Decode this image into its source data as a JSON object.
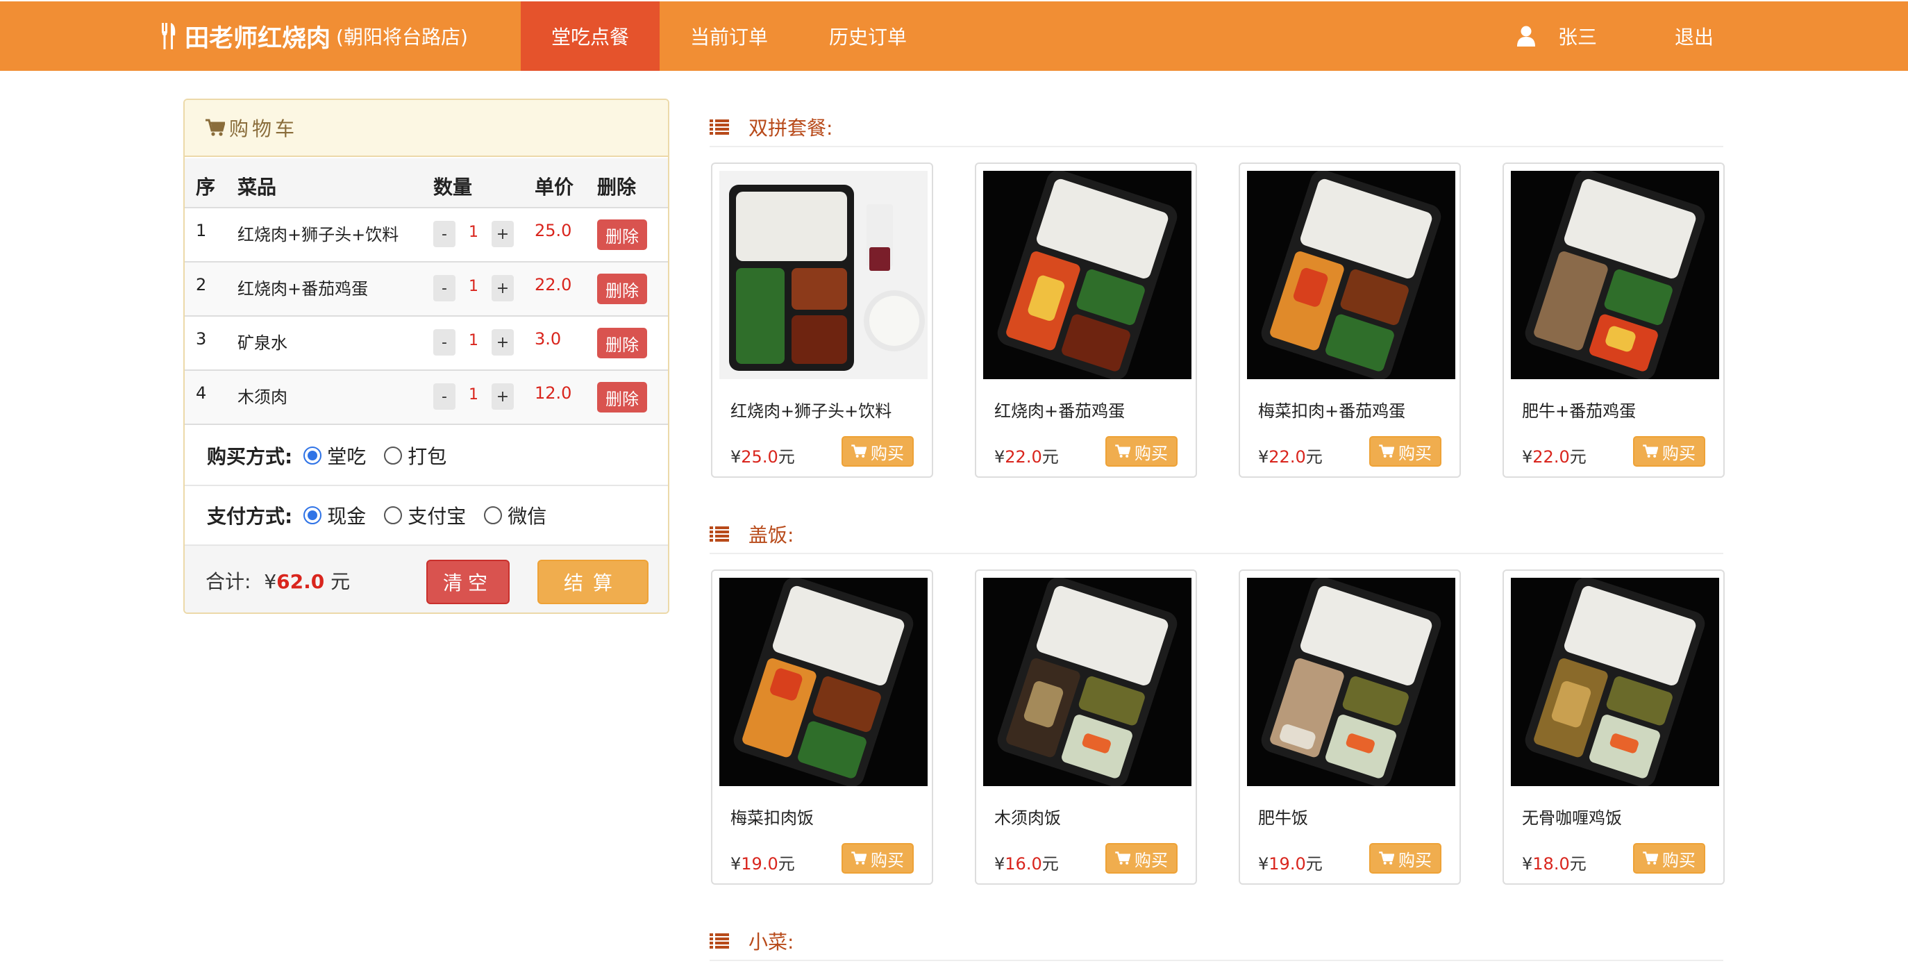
{
  "nav": {
    "brand_name": "田老师红烧肉",
    "brand_branch": "(朝阳将台路店)",
    "tabs": [
      {
        "label": "堂吃点餐",
        "active": true
      },
      {
        "label": "当前订单",
        "active": false
      },
      {
        "label": "历史订单",
        "active": false
      }
    ],
    "user_name": "张三",
    "logout_label": "退出",
    "icons": {
      "brand": "fork-knife-icon",
      "user": "user-icon"
    }
  },
  "cart": {
    "title": "购物车",
    "icon": "cart-icon",
    "headers": {
      "seq": "序",
      "name": "菜品",
      "qty": "数量",
      "price": "单价",
      "del": "删除"
    },
    "items": [
      {
        "seq": "1",
        "name": "红烧肉+狮子头+饮料",
        "qty": "1",
        "price": "25.0",
        "del": "删除",
        "minus": "-",
        "plus": "+"
      },
      {
        "seq": "2",
        "name": "红烧肉+番茄鸡蛋",
        "qty": "1",
        "price": "22.0",
        "del": "删除",
        "minus": "-",
        "plus": "+"
      },
      {
        "seq": "3",
        "name": "矿泉水",
        "qty": "1",
        "price": "3.0",
        "del": "删除",
        "minus": "-",
        "plus": "+"
      },
      {
        "seq": "4",
        "name": "木须肉",
        "qty": "1",
        "price": "12.0",
        "del": "删除",
        "minus": "-",
        "plus": "+"
      }
    ],
    "purchase_label": "购买方式:",
    "purchase_options": [
      {
        "label": "堂吃",
        "checked": true
      },
      {
        "label": "打包",
        "checked": false
      }
    ],
    "payment_label": "支付方式:",
    "payment_options": [
      {
        "label": "现金",
        "checked": true
      },
      {
        "label": "支付宝",
        "checked": false
      },
      {
        "label": "微信",
        "checked": false
      }
    ],
    "total_label": "合计:",
    "currency": "¥",
    "total_value": "62.0",
    "total_unit": "元",
    "clear_label": "清空",
    "checkout_label": "结算"
  },
  "menu": {
    "currency": "¥",
    "unit": "元",
    "buy_label": "购买",
    "sections": [
      {
        "title": "双拼套餐:",
        "items": [
          {
            "name": "红烧肉+狮子头+饮料",
            "price": "25.0"
          },
          {
            "name": "红烧肉+番茄鸡蛋",
            "price": "22.0"
          },
          {
            "name": "梅菜扣肉+番茄鸡蛋",
            "price": "22.0"
          },
          {
            "name": "肥牛+番茄鸡蛋",
            "price": "22.0"
          }
        ]
      },
      {
        "title": "盖饭:",
        "items": [
          {
            "name": "梅菜扣肉饭",
            "price": "19.0"
          },
          {
            "name": "木须肉饭",
            "price": "16.0"
          },
          {
            "name": "肥牛饭",
            "price": "19.0"
          },
          {
            "name": "无骨咖喱鸡饭",
            "price": "18.0"
          }
        ]
      },
      {
        "title": "小菜:",
        "items": []
      }
    ]
  },
  "colors": {
    "navbar": "#f18e34",
    "nav_active": "#e5532c",
    "danger": "#d9534f",
    "warning": "#f0ad4e",
    "price_red": "#d9251d",
    "section_title": "#b84a1a",
    "cart_header_bg": "#fcf7e3"
  }
}
